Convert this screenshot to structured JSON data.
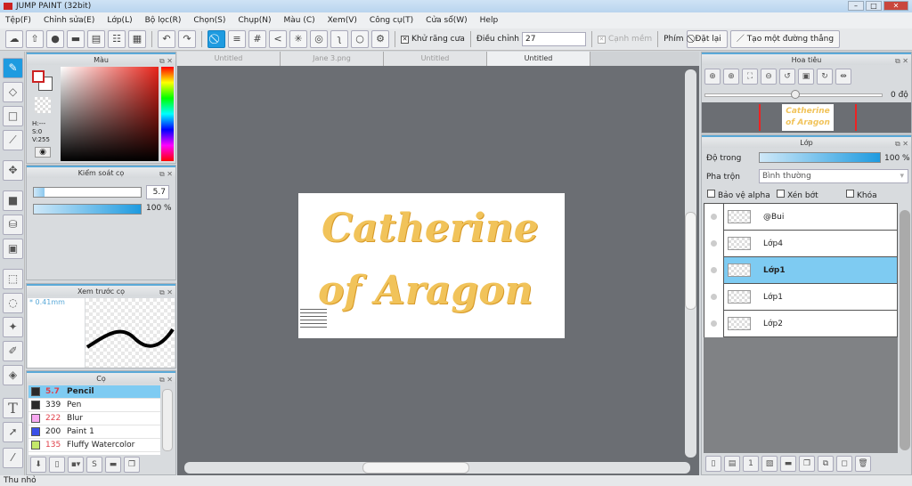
{
  "app": {
    "title": "JUMP PAINT (32bit)"
  },
  "menu": [
    "Tệp(F)",
    "Chỉnh sửa(E)",
    "Lớp(L)",
    "Bộ lọc(R)",
    "Chọn(S)",
    "Chụp(N)",
    "Màu (C)",
    "Xem(V)",
    "Công cụ(T)",
    "Cửa sổ(W)",
    "Help"
  ],
  "toolbar": {
    "antialias_label": "Khử răng cưa",
    "adjust_label": "Điều chỉnh",
    "adjust_value": "27",
    "soft_edge_label": "Cạnh mềm",
    "key_label": "Phím",
    "reset_label": "Đặt lại",
    "straight_line_label": "Tạo một đường thẳng"
  },
  "color_panel": {
    "title": "Màu",
    "h": "H:---",
    "s": "S:0",
    "v": "V:255"
  },
  "brush_control": {
    "title": "Kiểm soát cọ",
    "size": "5.7",
    "opacity": "100 %",
    "size_fraction": 0.1,
    "opacity_fraction": 1.0
  },
  "preview": {
    "title": "Xem trước cọ",
    "size_label": "* 0.41mm"
  },
  "brushes": {
    "title": "Cọ",
    "items": [
      {
        "size": "5.7",
        "name": "Pencil",
        "color": "#2a2a2a",
        "size_color": "#e0404a"
      },
      {
        "size": "339",
        "name": "Pen",
        "color": "#2a2a2a",
        "size_color": "#222222"
      },
      {
        "size": "222",
        "name": "Blur",
        "color": "#f7a8f0",
        "size_color": "#e0404a"
      },
      {
        "size": "200",
        "name": "Paint 1",
        "color": "#3a50e8",
        "size_color": "#222222"
      },
      {
        "size": "135",
        "name": "Fluffy Watercolor",
        "color": "#c4e86a",
        "size_color": "#e0404a"
      }
    ]
  },
  "tabs": [
    {
      "label": "Untitled",
      "active": false
    },
    {
      "label": "Jane 3.png",
      "active": false
    },
    {
      "label": "Untitled",
      "active": false
    },
    {
      "label": "Untitled",
      "active": true
    }
  ],
  "canvas": {
    "line1": "Catherine",
    "line2": "of Aragon"
  },
  "navigator": {
    "title": "Hoa tiêu",
    "angle": "0 độ"
  },
  "layers": {
    "title": "Lớp",
    "opacity_label": "Độ trong",
    "opacity_value": "100 %",
    "blend_label": "Pha trộn",
    "blend_value": "Bình thường",
    "protect_alpha": "Bảo vệ alpha",
    "clipping": "Xén bớt",
    "lock": "Khóa",
    "items": [
      {
        "name": "@Bui",
        "selected": false
      },
      {
        "name": "Lớp4",
        "selected": false
      },
      {
        "name": "Lớp1",
        "selected": true
      },
      {
        "name": "Lớp1",
        "selected": false
      },
      {
        "name": "Lớp2",
        "selected": false
      }
    ]
  },
  "status": {
    "text": "Thu nhỏ"
  }
}
